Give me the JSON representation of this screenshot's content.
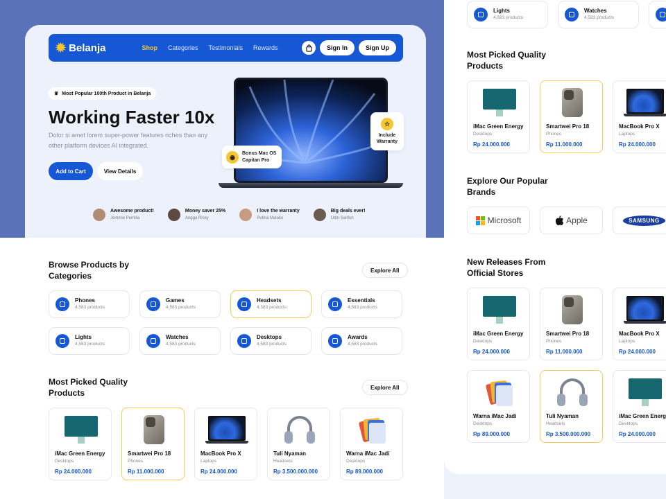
{
  "brand": {
    "name": "Belanja"
  },
  "nav": {
    "items": [
      "Shop",
      "Categories",
      "Testimonials",
      "Rewards"
    ],
    "signin": "Sign In",
    "signup": "Sign Up"
  },
  "hero": {
    "badge": "Most Popular 100th Product in Belanja",
    "title": "Working Faster 10x",
    "desc": "Dolor si amet lorem super-power features riches than any other platform devices AI integrated.",
    "cta_primary": "Add to Cart",
    "cta_secondary": "View Details",
    "chip_a": "Bonus Mac OS Capitan Pro",
    "chip_b": "Include Warranty"
  },
  "reviews": [
    {
      "title": "Awesome product!",
      "name": "Jemmie Pemilia"
    },
    {
      "title": "Money saver 25%",
      "name": "Angga Risky"
    },
    {
      "title": "I love the warranty",
      "name": "Petina Malako"
    },
    {
      "title": "Big deals ever!",
      "name": "Udin Sarifun"
    }
  ],
  "categories": {
    "title": "Browse Products by Categories",
    "explore": "Explore All",
    "items": [
      {
        "name": "Phones",
        "count": "4,583 products"
      },
      {
        "name": "Games",
        "count": "4,583 products"
      },
      {
        "name": "Headsets",
        "count": "4,583 products"
      },
      {
        "name": "Essentials",
        "count": "4,583 products"
      },
      {
        "name": "Lights",
        "count": "4,583 products"
      },
      {
        "name": "Watches",
        "count": "4,583 products"
      },
      {
        "name": "Desktops",
        "count": "4,583 products"
      },
      {
        "name": "Awards",
        "count": "4,583 products"
      }
    ]
  },
  "picked": {
    "title": "Most Picked Quality Products",
    "explore": "Explore All",
    "items": [
      {
        "name": "iMac Green Energy",
        "cat": "Desktops",
        "price": "Rp 24.000.000"
      },
      {
        "name": "Smartwei Pro 18",
        "cat": "Phones",
        "price": "Rp 11.000.000"
      },
      {
        "name": "MacBook Pro X",
        "cat": "Laptops",
        "price": "Rp 24.000.000"
      },
      {
        "name": "Tuli Nyaman",
        "cat": "Headsets",
        "price": "Rp 3.500.000.000"
      },
      {
        "name": "Warna iMac Jadi",
        "cat": "Desktops",
        "price": "Rp 89.000.000"
      }
    ]
  },
  "right": {
    "top_cats": [
      {
        "name": "Lights",
        "count": "4,583 products"
      },
      {
        "name": "Watches",
        "count": "4,583 products"
      }
    ],
    "picked_title": "Most Picked Quality Products",
    "picked": [
      {
        "name": "iMac Green Energy",
        "cat": "Desktops",
        "price": "Rp 24.000.000"
      },
      {
        "name": "Smartwei Pro 18",
        "cat": "Phones",
        "price": "Rp 11.000.000"
      },
      {
        "name": "MacBook Pro X",
        "cat": "Laptops",
        "price": "Rp 24.000.000"
      }
    ],
    "brands_title": "Explore Our Popular Brands",
    "brands": [
      "Microsoft",
      "Apple",
      "SAMSUNG"
    ],
    "releases_title": "New Releases From Official Stores",
    "releases": [
      {
        "name": "iMac Green Energy",
        "cat": "Desktops",
        "price": "Rp 24.000.000"
      },
      {
        "name": "Smartwei Pro 18",
        "cat": "Phones",
        "price": "Rp 11.000.000"
      },
      {
        "name": "MacBook Pro X",
        "cat": "Laptops",
        "price": "Rp 24.000.000"
      },
      {
        "name": "Warna iMac Jadi",
        "cat": "Desktops",
        "price": "Rp 89.000.000"
      },
      {
        "name": "Tuli Nyaman",
        "cat": "Headsets",
        "price": "Rp 3.500.000.000"
      },
      {
        "name": "iMac Green Energy",
        "cat": "Desktops",
        "price": "Rp 24.000.000"
      }
    ]
  },
  "colors": {
    "primary": "#1557d4",
    "accent": "#f7c631",
    "hero_bg": "#ecf1fb",
    "page_bg": "#5a72b8"
  }
}
